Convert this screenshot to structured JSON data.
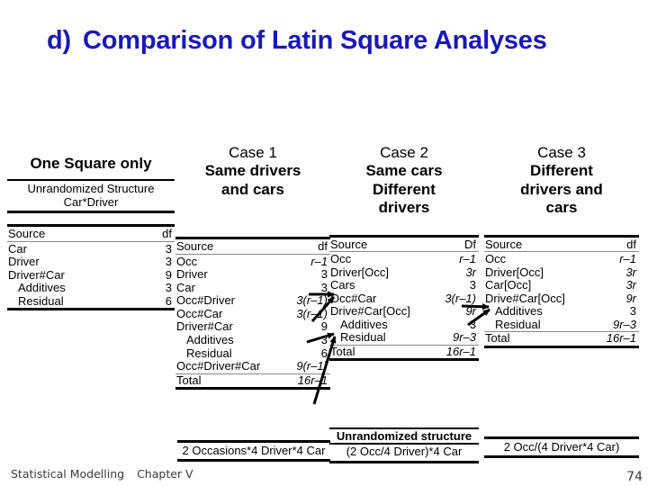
{
  "slide": {
    "title_marker": "d)",
    "title_text": "Comparison of Latin Square Analyses",
    "title_color": "#1a18b5",
    "footer_left": "Statistical Modelling",
    "footer_chapter": "Chapter V",
    "page_number": "74"
  },
  "columns": {
    "one_square": {
      "title": "One Square only",
      "struct_line1": "Unrandomized Structure",
      "struct_line2": "Car*Driver",
      "table": {
        "headers": [
          "Source",
          "df"
        ],
        "rows": [
          {
            "source": "Car",
            "df": "3",
            "indent": false
          },
          {
            "source": "Driver",
            "df": "3",
            "indent": false
          },
          {
            "source": "Driver#Car",
            "df": "9",
            "indent": false
          },
          {
            "source": "Additives",
            "df": "3",
            "indent": true
          },
          {
            "source": "Residual",
            "df": "6",
            "indent": true
          }
        ]
      }
    },
    "case1": {
      "label": "Case 1",
      "sub_line1": "Same drivers",
      "sub_line2": "and cars",
      "table": {
        "headers": [
          "Source",
          "df"
        ],
        "rows": [
          {
            "source": "Occ",
            "df": "r–1",
            "indent": false
          },
          {
            "source": "Driver",
            "df": "3",
            "indent": false
          },
          {
            "source": "Car",
            "df": "3",
            "indent": false
          },
          {
            "source": "Occ#Driver",
            "df": "3(r–1)",
            "indent": false
          },
          {
            "source": "Occ#Car",
            "df": "3(r–1)",
            "indent": false
          },
          {
            "source": "Driver#Car",
            "df": "9",
            "indent": false
          },
          {
            "source": "Additives",
            "df": "3",
            "indent": true
          },
          {
            "source": "Residual",
            "df": "6",
            "indent": true
          },
          {
            "source": "Occ#Driver#Car",
            "df": "9(r–1)",
            "indent": false
          }
        ],
        "total": {
          "source": "Total",
          "df": "16r–1"
        }
      },
      "footbox_title": "",
      "footbox_body": "2 Occasions*4 Driver*4 Car"
    },
    "case2": {
      "label": "Case 2",
      "sub_line1": "Same cars",
      "sub_line2": "Different",
      "sub_line3": "drivers",
      "table": {
        "headers": [
          "Source",
          "Df"
        ],
        "rows": [
          {
            "source": "Occ",
            "df": "r–1",
            "indent": false
          },
          {
            "source": "Driver[Occ]",
            "df": "3r",
            "indent": false
          },
          {
            "source": "Cars",
            "df": "3",
            "indent": false
          },
          {
            "source": "Occ#Car",
            "df": "3(r–1)",
            "indent": false
          },
          {
            "source": "Drive#Car[Occ]",
            "df": "9r",
            "indent": false
          },
          {
            "source": "Additives",
            "df": "3",
            "indent": true
          },
          {
            "source": "Residual",
            "df": "9r–3",
            "indent": true
          }
        ],
        "total": {
          "source": "Total",
          "df": "16r–1"
        }
      },
      "footbox_title": "Unrandomized structure",
      "footbox_body": "(2 Occ/4 Driver)*4 Car"
    },
    "case3": {
      "label": "Case 3",
      "sub_line1": "Different",
      "sub_line2": "drivers and",
      "sub_line3": "cars",
      "table": {
        "headers": [
          "Source",
          "df"
        ],
        "rows": [
          {
            "source": "Occ",
            "df": "r–1",
            "indent": false
          },
          {
            "source": "Driver[Occ]",
            "df": "3r",
            "indent": false
          },
          {
            "source": "Car[Occ]",
            "df": "3r",
            "indent": false
          },
          {
            "source": "Drive#Car[Occ]",
            "df": "9r",
            "indent": false
          },
          {
            "source": "Additives",
            "df": "3",
            "indent": true
          },
          {
            "source": "Residual",
            "df": "9r–3",
            "indent": true
          }
        ],
        "total": {
          "source": "Total",
          "df": "16r–1"
        }
      },
      "footbox_title": "",
      "footbox_body": "2 Occ/(4 Driver*4 Car)"
    }
  }
}
